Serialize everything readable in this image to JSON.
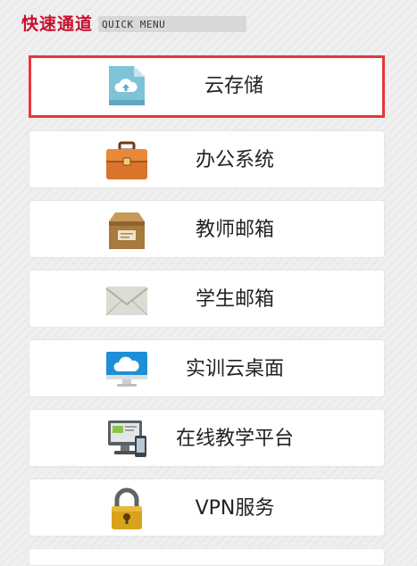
{
  "header": {
    "title": "快速通道",
    "subtitle": "QUICK MENU"
  },
  "menu": {
    "items": [
      {
        "label": "云存储",
        "icon": "cloud-upload-file-icon",
        "selected": true
      },
      {
        "label": "办公系统",
        "icon": "briefcase-icon"
      },
      {
        "label": "教师邮箱",
        "icon": "cardboard-box-icon"
      },
      {
        "label": "学生邮箱",
        "icon": "envelope-icon"
      },
      {
        "label": "实训云桌面",
        "icon": "cloud-monitor-icon"
      },
      {
        "label": "在线教学平台",
        "icon": "computer-devices-icon"
      },
      {
        "label": "VPN服务",
        "icon": "padlock-icon"
      }
    ]
  },
  "colors": {
    "brand_red": "#c8102e",
    "selection_border": "#e8363a",
    "card_bg": "#ffffff"
  }
}
